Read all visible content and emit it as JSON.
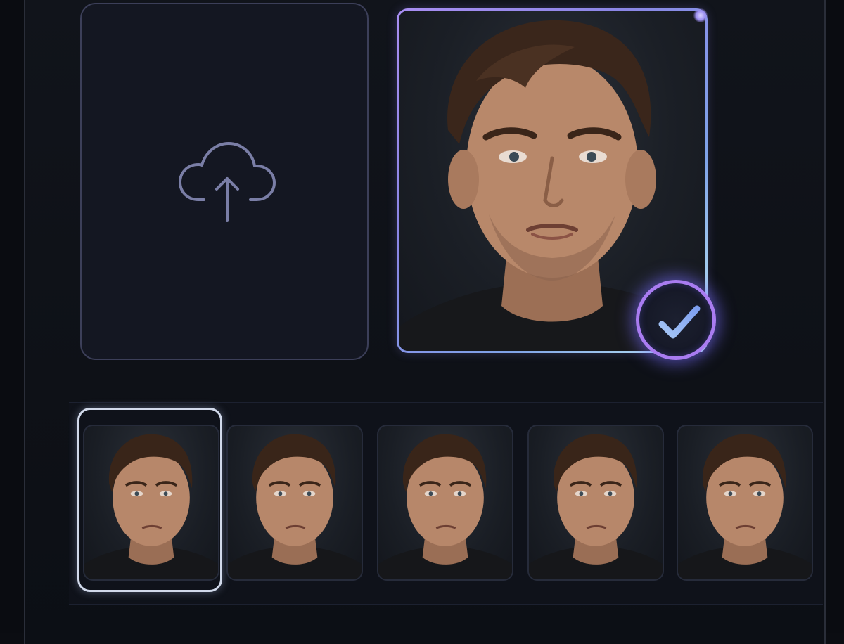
{
  "upload_area": {
    "icon": "cloud-upload-icon"
  },
  "selected_photo": {
    "subject": "portrait",
    "status_icon": "checkmark-icon"
  },
  "thumbnails": {
    "count": 5,
    "selected_index": 0,
    "items": [
      {
        "icon": "portrait-thumbnail"
      },
      {
        "icon": "portrait-thumbnail"
      },
      {
        "icon": "portrait-thumbnail"
      },
      {
        "icon": "portrait-thumbnail"
      },
      {
        "icon": "portrait-thumbnail"
      }
    ]
  },
  "colors": {
    "background": "#0b0d12",
    "accent_purple": "#a97cf1",
    "accent_blue": "#7fa3e8",
    "check_color": "#8fb8f2",
    "upload_border": "#3c3f59"
  }
}
